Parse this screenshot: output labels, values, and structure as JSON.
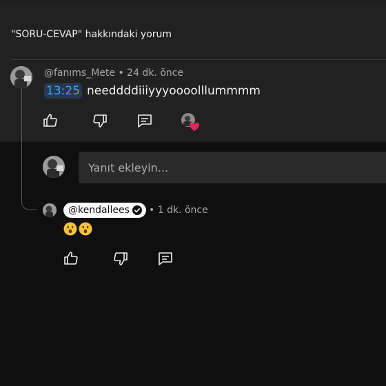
{
  "panel": {
    "title": "\"SORU-CEVAP\" hakkındaki yorum"
  },
  "comment": {
    "author": "@fanıms_Mete",
    "time": "• 24 dk. önce",
    "timestamp_link": "13:25",
    "text": "needdddiiiyyyoooolllummmm",
    "icons": [
      "thumb-up-icon",
      "thumb-down-icon",
      "reply-icon",
      "creator-heart-icon"
    ]
  },
  "reply_box": {
    "placeholder": "Yanıt ekleyin..."
  },
  "reply": {
    "author": "@kendallees",
    "time": "• 1 dk. önce",
    "emoji": [
      "😮",
      "😮"
    ],
    "icons": [
      "thumb-up-icon",
      "thumb-down-icon",
      "reply-icon"
    ]
  },
  "colors": {
    "background": "#0f0f0f",
    "panel": "#212121",
    "timestamp_link": "#3ea6ff",
    "heart": "#e0245e"
  }
}
